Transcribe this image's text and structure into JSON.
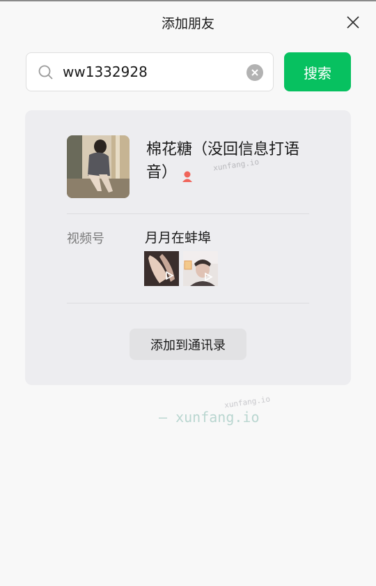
{
  "header": {
    "title": "添加朋友"
  },
  "search": {
    "value": "ww1332928",
    "button_label": "搜索"
  },
  "result": {
    "nickname": "棉花糖（没回信息打语音）",
    "gender": "female",
    "channel": {
      "label": "视频号",
      "name": "月月在蚌埠",
      "video_count": 2
    },
    "add_button_label": "添加到通讯录"
  },
  "watermarks": {
    "inline": "xunfang.io",
    "small": "xunfang.io",
    "main": "— xunfang.io"
  },
  "colors": {
    "accent": "#07c160",
    "card": "#ededf0",
    "background": "#f8f8f8",
    "gender_female": "#f0645a"
  }
}
